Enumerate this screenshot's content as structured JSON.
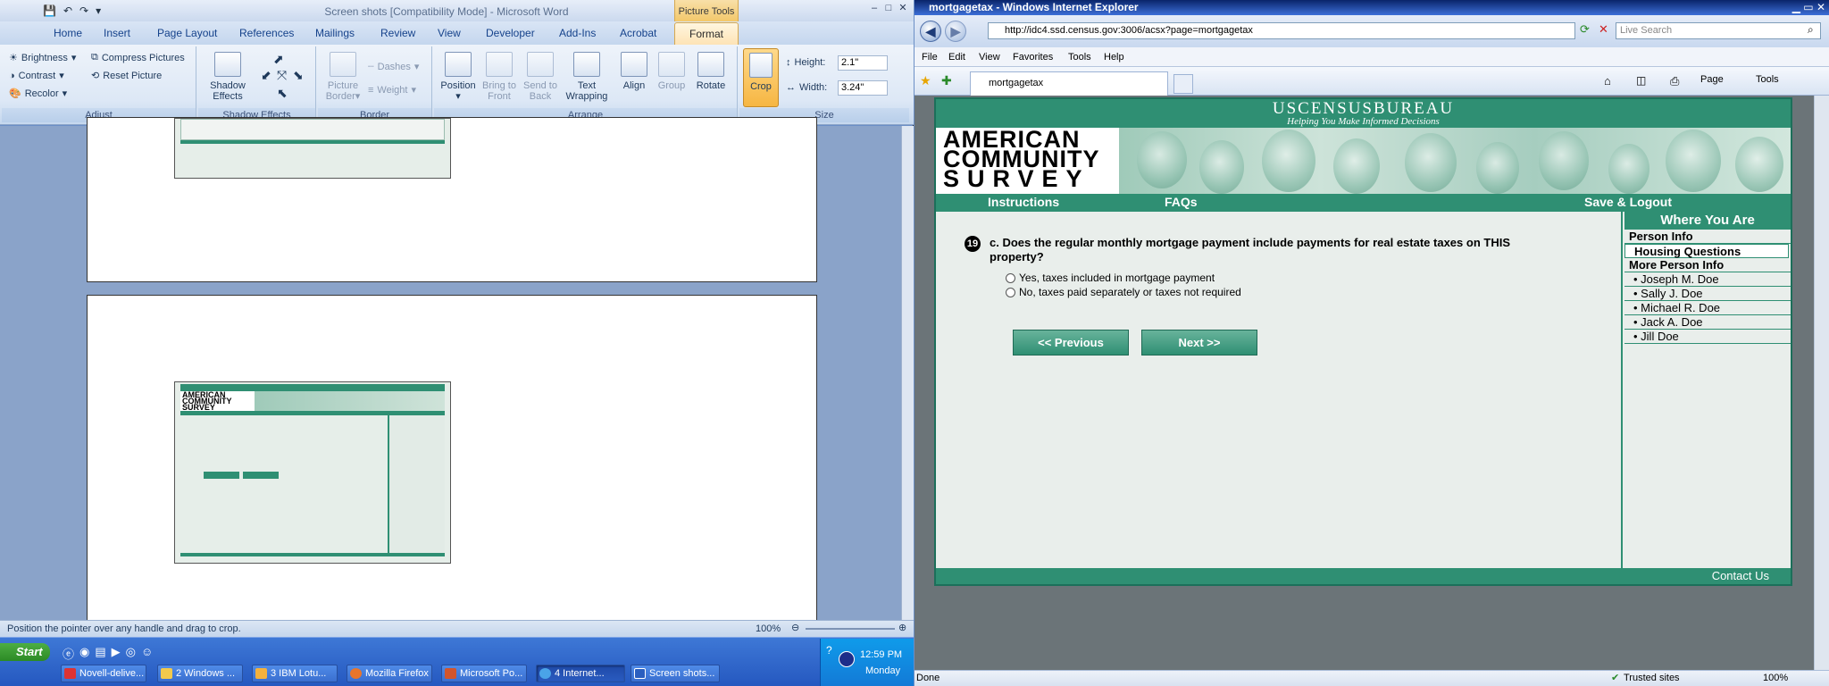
{
  "word": {
    "title": "Screen shots [Compatibility Mode] - Microsoft Word",
    "picture_tools": "Picture Tools",
    "tabs": [
      "Home",
      "Insert",
      "Page Layout",
      "References",
      "Mailings",
      "Review",
      "View",
      "Developer",
      "Add-Ins",
      "Acrobat",
      "Format"
    ],
    "active_tab": "Format",
    "ribbon": {
      "adjust": {
        "brightness": "Brightness",
        "contrast": "Contrast",
        "recolor": "Recolor",
        "compress": "Compress Pictures",
        "reset": "Reset Picture",
        "label": "Adjust"
      },
      "shadow": {
        "effects": "Shadow Effects",
        "label": "Shadow Effects"
      },
      "border": {
        "picture_border": "Picture Border",
        "dashes": "Dashes",
        "weight": "Weight",
        "label": "Border"
      },
      "arrange": {
        "position": "Position",
        "bring_to_front": "Bring to Front",
        "send_to_back": "Send to Back",
        "text_wrapping": "Text Wrapping",
        "align": "Align",
        "group": "Group",
        "rotate": "Rotate",
        "label": "Arrange"
      },
      "size": {
        "crop": "Crop",
        "height_label": "Height:",
        "height_value": "2.1\"",
        "width_label": "Width:",
        "width_value": "3.24\"",
        "label": "Size"
      }
    },
    "status_text": "Position the pointer over any handle and drag to crop.",
    "zoom": "100%"
  },
  "taskbar": {
    "start": "Start",
    "items": [
      "Novell-delive...",
      "2 Windows ...",
      "3 IBM Lotu...",
      "Mozilla Firefox",
      "Microsoft Po...",
      "4 Internet...",
      "Screen shots..."
    ],
    "time": "12:59 PM",
    "day": "Monday"
  },
  "ie": {
    "title": "mortgagetax - Windows Internet Explorer",
    "url": "http://idc4.ssd.census.gov:3006/acsx?page=mortgagetax",
    "search_placeholder": "Live Search",
    "menu": [
      "File",
      "Edit",
      "View",
      "Favorites",
      "Tools",
      "Help"
    ],
    "tab_title": "mortgagetax",
    "toolbar": {
      "page": "Page",
      "tools": "Tools"
    },
    "status_left": "Done",
    "status_zone": "Trusted sites",
    "zoom": "100%"
  },
  "census": {
    "bureau": "USCENSUSBUREAU",
    "tagline": "Helping You Make Informed Decisions",
    "logo_lines": [
      "AMERICAN",
      "COMMUNITY",
      "SURVEY"
    ],
    "nav": {
      "instructions": "Instructions",
      "faqs": "FAQs",
      "save": "Save & Logout"
    },
    "question_number": "19",
    "question": "c. Does the regular monthly mortgage payment include payments for real estate taxes on THIS property?",
    "options": [
      "Yes, taxes included in mortgage payment",
      "No, taxes paid separately or taxes not required"
    ],
    "prev": "<<   Previous",
    "next": "Next   >>",
    "sidebar": {
      "header": "Where You Are",
      "person_info": "Person Info",
      "current": "Housing Questions",
      "more": "More Person Info",
      "people": [
        "• Joseph M. Doe",
        "• Sally J. Doe",
        "• Michael R. Doe",
        "• Jack A. Doe",
        "• Jill Doe"
      ]
    },
    "footer": "Contact Us"
  },
  "colors": {
    "census_green": "#2f8f73",
    "word_blue": "#6b8fc6",
    "taskbar": "#2558c0"
  }
}
